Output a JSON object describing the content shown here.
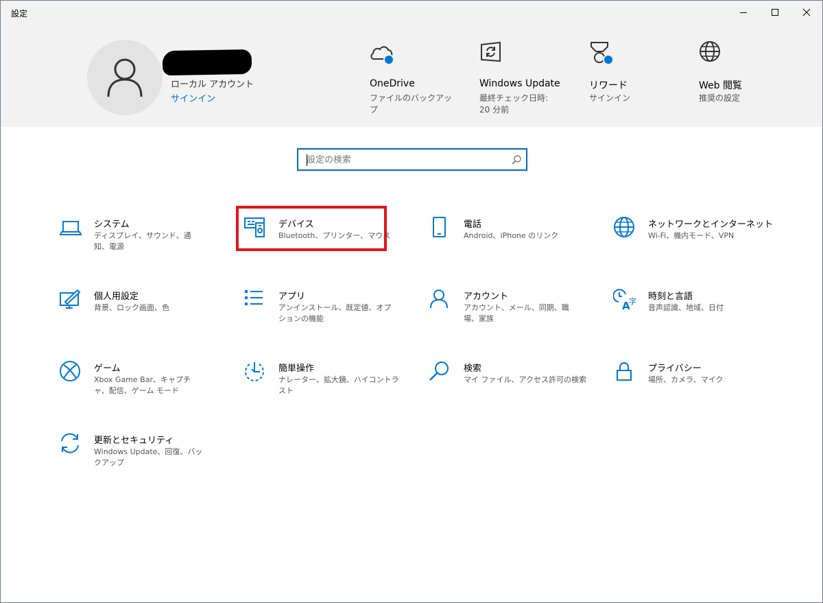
{
  "window": {
    "title": "設定"
  },
  "account": {
    "type": "ローカル アカウント",
    "signin": "サインイン"
  },
  "header_items": [
    {
      "title": "OneDrive",
      "subtitle": "ファイルのバックアップ",
      "icon": "cloud-icon"
    },
    {
      "title": "Windows Update",
      "subtitle": "最終チェック日時: 20 分前",
      "icon": "windows-update-icon"
    },
    {
      "title": "リワード",
      "subtitle": "サインイン",
      "icon": "medal-icon"
    },
    {
      "title": "Web 閲覧",
      "subtitle": "推奨の設定",
      "icon": "globe-icon"
    }
  ],
  "search": {
    "placeholder": "設定の検索"
  },
  "categories": [
    {
      "title": "システム",
      "desc": "ディスプレイ、サウンド、通知、電源",
      "icon": "laptop-icon"
    },
    {
      "title": "デバイス",
      "desc": "Bluetooth、プリンター、マウス",
      "icon": "devices-icon"
    },
    {
      "title": "電話",
      "desc": "Android、iPhone のリンク",
      "icon": "phone-icon"
    },
    {
      "title": "ネットワークとインターネット",
      "desc": "Wi-Fi、機内モード、VPN",
      "icon": "globe-icon"
    },
    {
      "title": "個人用設定",
      "desc": "背景、ロック画面、色",
      "icon": "personalization-icon"
    },
    {
      "title": "アプリ",
      "desc": "アンインストール、既定値、オプションの機能",
      "icon": "apps-list-icon"
    },
    {
      "title": "アカウント",
      "desc": "アカウント、メール、同期、職場、家族",
      "icon": "person-icon"
    },
    {
      "title": "時刻と言語",
      "desc": "音声認識、地域、日付",
      "icon": "time-language-icon"
    },
    {
      "title": "ゲーム",
      "desc": "Xbox Game Bar、キャプチャ、配信、ゲーム モード",
      "icon": "xbox-icon"
    },
    {
      "title": "簡単操作",
      "desc": "ナレーター、拡大鏡、ハイコントラスト",
      "icon": "ease-of-access-icon"
    },
    {
      "title": "検索",
      "desc": "マイ ファイル、アクセス許可の検索",
      "icon": "search-icon"
    },
    {
      "title": "プライバシー",
      "desc": "場所、カメラ、マイク",
      "icon": "lock-icon"
    },
    {
      "title": "更新とセキュリティ",
      "desc": "Windows Update、回復、バックアップ",
      "icon": "update-sync-icon"
    }
  ],
  "colors": {
    "accent": "#0067c0",
    "icon_blue": "#0078d7",
    "highlight": "#e3131c",
    "header_bg": "#f2f2f2"
  }
}
